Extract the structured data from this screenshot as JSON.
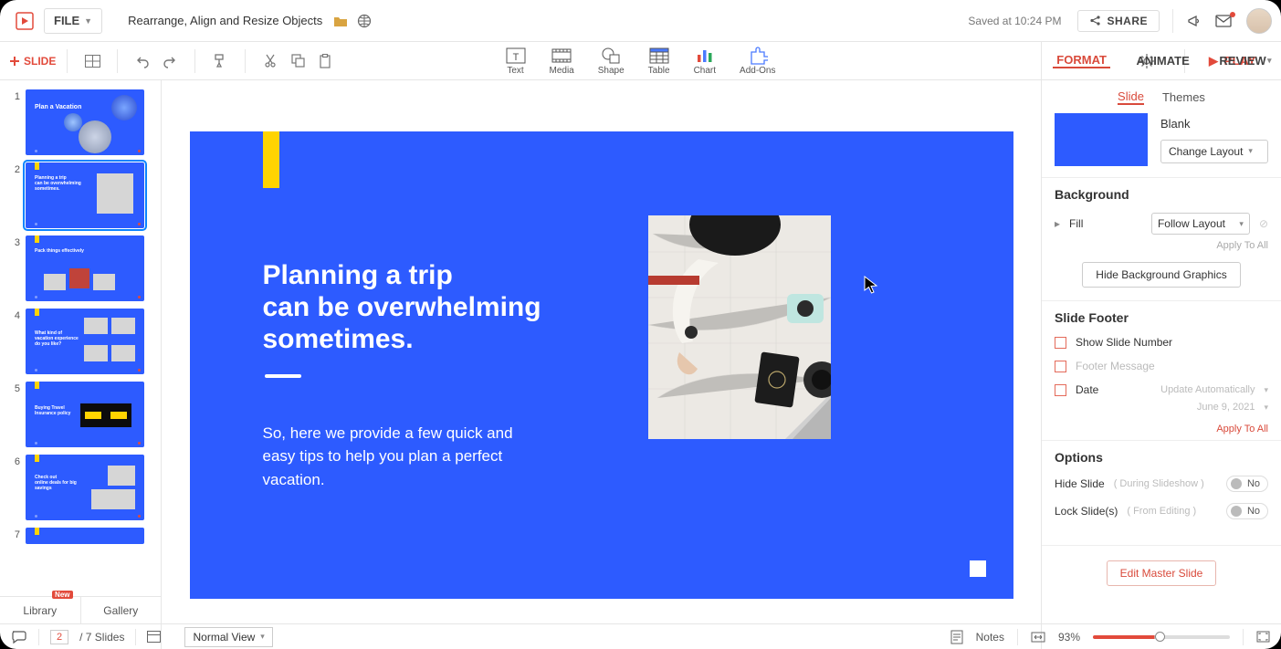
{
  "menubar": {
    "file_label": "FILE",
    "doc_title": "Rearrange, Align and Resize Objects",
    "saved_at": "Saved at 10:24 PM",
    "share_label": "SHARE"
  },
  "toolbar": {
    "add_slide_label": "SLIDE",
    "insert": {
      "text": "Text",
      "media": "Media",
      "shape": "Shape",
      "table": "Table",
      "chart": "Chart",
      "addons": "Add-Ons"
    },
    "play_label": "PLAY"
  },
  "panel_tabs": {
    "format": "FORMAT",
    "animate": "ANIMATE",
    "review": "REVIEW"
  },
  "props": {
    "subtabs": {
      "slide": "Slide",
      "themes": "Themes"
    },
    "layout_name": "Blank",
    "change_layout": "Change Layout",
    "background": {
      "title": "Background",
      "fill_label": "Fill",
      "fill_value": "Follow Layout",
      "apply_all": "Apply To All",
      "hide_bg_btn": "Hide Background Graphics"
    },
    "footer": {
      "title": "Slide Footer",
      "show_number": "Show Slide Number",
      "footer_msg": "Footer Message",
      "date_label": "Date",
      "date_mode": "Update Automatically",
      "date_value": "June 9, 2021",
      "apply_all": "Apply To All"
    },
    "options": {
      "title": "Options",
      "hide_slide": "Hide Slide",
      "hide_slide_note": "( During Slideshow )",
      "lock_slides": "Lock Slide(s)",
      "lock_slides_note": "( From Editing )",
      "toggle_no": "No"
    },
    "edit_master": "Edit Master Slide"
  },
  "slide": {
    "heading_l1": "Planning a trip",
    "heading_l2": "can be overwhelming",
    "heading_l3": "sometimes.",
    "body": "So, here we provide a few quick and easy tips to help you plan a perfect vacation."
  },
  "thumbs": [
    "1",
    "2",
    "3",
    "4",
    "5",
    "6",
    "7"
  ],
  "footer_tabs": {
    "library": "Library",
    "gallery": "Gallery",
    "new_badge": "New"
  },
  "status": {
    "current_slide": "2",
    "total_label": "/ 7 Slides",
    "view_mode": "Normal View",
    "notes_label": "Notes",
    "zoom_pct": "93%"
  }
}
